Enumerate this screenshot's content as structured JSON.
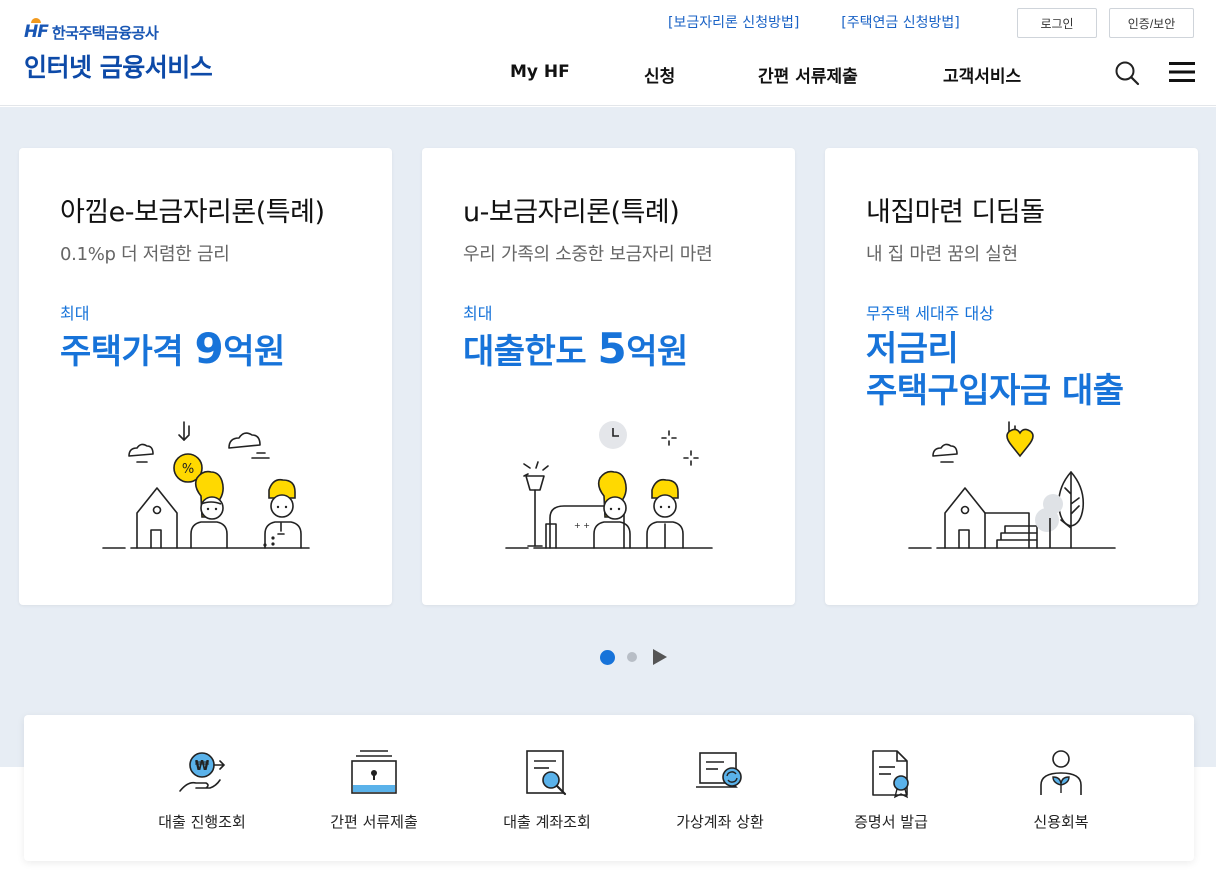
{
  "brand": {
    "logo_mark": "HF",
    "org_name": "한국주택금융공사",
    "service_title": "인터넷 금융서비스"
  },
  "util_links": [
    "[보금자리론 신청방법]",
    "[주택연금 신청방법]"
  ],
  "util_buttons": {
    "login": "로그인",
    "cert": "인증/보안"
  },
  "gnb": [
    "My HF",
    "신청",
    "간편 서류제출",
    "고객서비스"
  ],
  "cards": [
    {
      "title": "아낌e-보금자리론(특례)",
      "subtitle": "0.1%p 더 저렴한 금리",
      "tag": "최대",
      "headline_pre": "주택가격 ",
      "headline_num": "9",
      "headline_post": "억원"
    },
    {
      "title": "u-보금자리론(특례)",
      "subtitle": "우리 가족의 소중한 보금자리 마련",
      "tag": "최대",
      "headline_pre": "대출한도 ",
      "headline_num": "5",
      "headline_post": "억원"
    },
    {
      "title": "내집마련 디딤돌",
      "subtitle": "내 집 마련 꿈의 실현",
      "tag": "무주택 세대주 대상",
      "headline_line1": "저금리",
      "headline_line2": "주택구입자금 대출"
    }
  ],
  "pager": {
    "current": 1,
    "total": 2
  },
  "quick_menu": [
    {
      "label": "대출 진행조회",
      "icon": "coin-hand-icon"
    },
    {
      "label": "간편 서류제출",
      "icon": "document-tray-icon"
    },
    {
      "label": "대출 계좌조회",
      "icon": "document-search-icon"
    },
    {
      "label": "가상계좌 상환",
      "icon": "laptop-refresh-icon"
    },
    {
      "label": "증명서 발급",
      "icon": "certificate-icon"
    },
    {
      "label": "신용회복",
      "icon": "person-sprout-icon"
    }
  ],
  "colors": {
    "brand_blue": "#0d4aa8",
    "accent_blue": "#1773d9",
    "yellow": "#ffd900",
    "hero_bg": "#e7edf4"
  }
}
